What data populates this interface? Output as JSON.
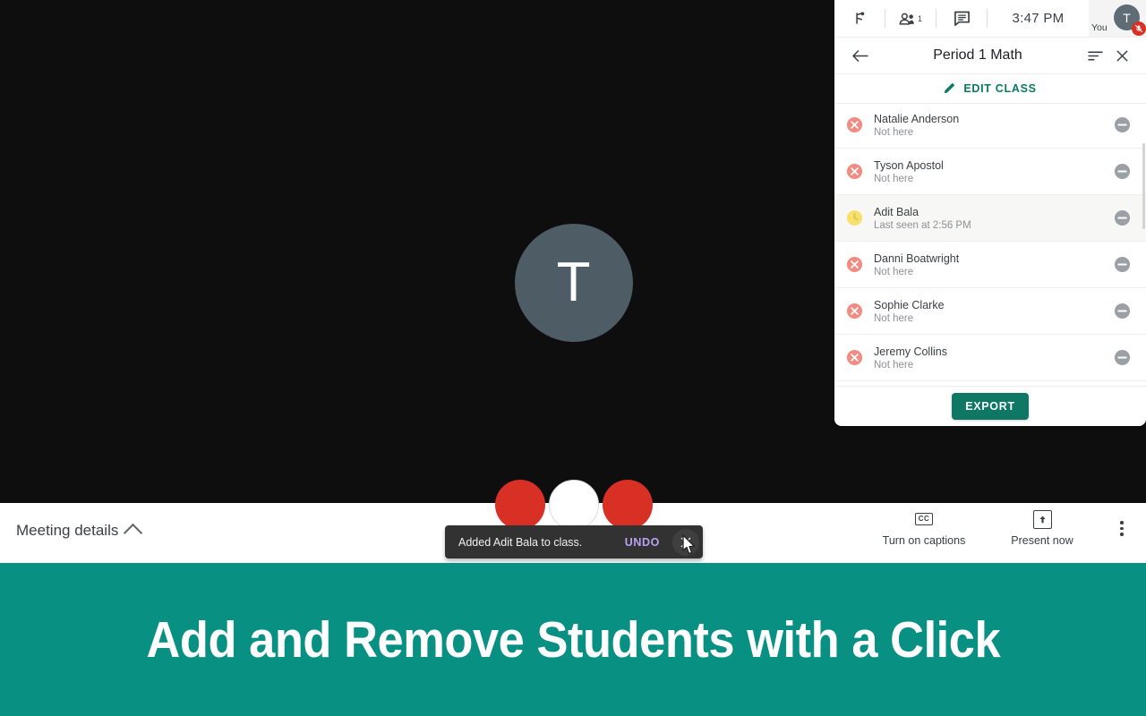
{
  "meeting": {
    "self_avatar_initial": "T",
    "details_label": "Meeting details",
    "chevron_icon": "chevron-up-icon",
    "controls": {
      "mic_icon": "mic-off-icon",
      "camera_icon": "camera-icon",
      "hangup_icon": "hang-up-icon"
    },
    "actions": [
      {
        "label": "Turn on captions",
        "icon": "closed-captions-icon",
        "glyph": "CC"
      },
      {
        "label": "Present now",
        "icon": "present-now-icon",
        "glyph": "↑"
      }
    ],
    "more_options_icon": "more-vertical-icon"
  },
  "snackbar": {
    "message": "Added Adit Bala to class.",
    "action_label": "UNDO",
    "close_icon": "close-icon"
  },
  "panel": {
    "toolbar": {
      "raise_hand_icon": "raise-hand-icon",
      "people_icon": "people-icon",
      "people_count": "1",
      "chat_icon": "chat-icon",
      "time": "3:47  PM",
      "you_label": "You",
      "you_avatar_initial": "T",
      "mute_badge_icon": "mic-off-icon"
    },
    "header": {
      "back_icon": "arrow-back-icon",
      "title": "Period 1 Math",
      "sort_icon": "sort-icon",
      "close_icon": "close-icon"
    },
    "edit_class": {
      "label": "EDIT CLASS",
      "icon": "pencil-icon"
    },
    "students": [
      {
        "name": "Natalie Anderson",
        "status": "Not here",
        "status_icon": "absent-x-icon",
        "status_color": "#f28b82",
        "highlighted": false,
        "remove_icon": "remove-circle-icon"
      },
      {
        "name": "Tyson Apostol",
        "status": "Not here",
        "status_icon": "absent-x-icon",
        "status_color": "#f28b82",
        "highlighted": false,
        "remove_icon": "remove-circle-icon"
      },
      {
        "name": "Adit Bala",
        "status": "Last seen at 2:56 PM",
        "status_icon": "clock-icon",
        "status_color": "#f7e06e",
        "highlighted": true,
        "remove_icon": "remove-circle-icon"
      },
      {
        "name": "Danni Boatwright",
        "status": "Not here",
        "status_icon": "absent-x-icon",
        "status_color": "#f28b82",
        "highlighted": false,
        "remove_icon": "remove-circle-icon"
      },
      {
        "name": "Sophie Clarke",
        "status": "Not here",
        "status_icon": "absent-x-icon",
        "status_color": "#f28b82",
        "highlighted": false,
        "remove_icon": "remove-circle-icon"
      },
      {
        "name": "Jeremy Collins",
        "status": "Not here",
        "status_icon": "absent-x-icon",
        "status_color": "#f28b82",
        "highlighted": false,
        "remove_icon": "remove-circle-icon"
      }
    ],
    "export_label": "EXPORT"
  },
  "banner": {
    "headline": "Add and Remove Students with a Click",
    "background_color": "#089082",
    "text_color": "#ffffff"
  },
  "colors": {
    "accent_teal": "#0f7864",
    "banner_teal": "#089082",
    "danger_red": "#d93025",
    "absent_red": "#f28b82",
    "pending_yellow": "#f7e06e",
    "undo_purple": "#b9a3f0",
    "snackbar_bg": "#323232"
  }
}
